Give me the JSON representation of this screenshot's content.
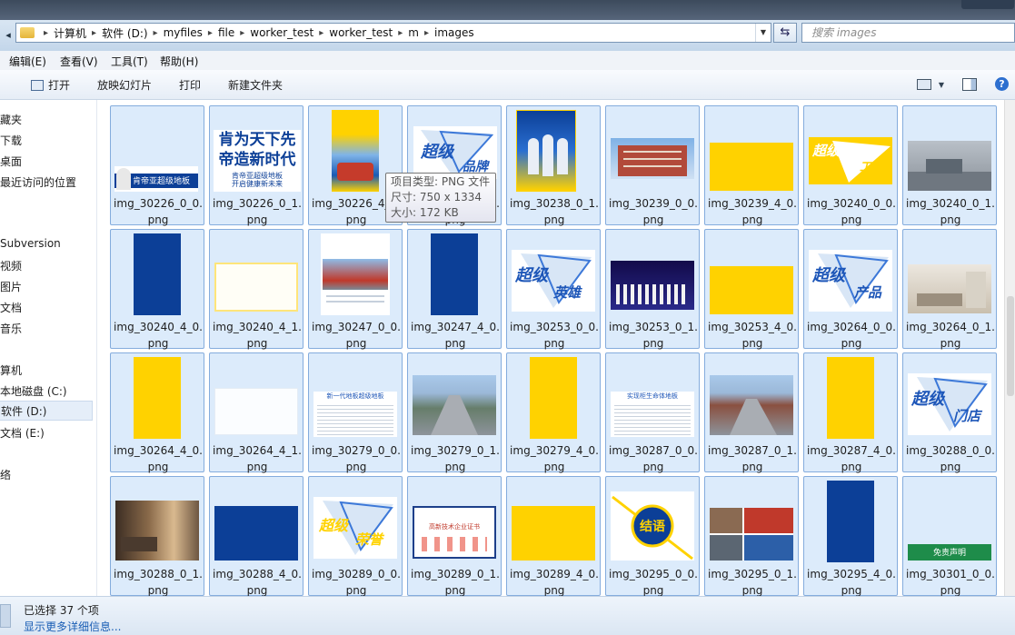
{
  "address": {
    "crumbs": [
      "计算机",
      "软件 (D:)",
      "myfiles",
      "file",
      "worker_test",
      "worker_test",
      "m",
      "images"
    ],
    "search_placeholder": "搜索 images"
  },
  "menu": [
    "编辑(E)",
    "查看(V)",
    "工具(T)",
    "帮助(H)"
  ],
  "toolbar": {
    "open": "打开",
    "slideshow": "放映幻灯片",
    "print": "打印",
    "new_folder": "新建文件夹"
  },
  "sidebar": [
    "藏夹",
    "下载",
    "桌面",
    "最近访问的位置",
    "Subversion",
    "视频",
    "图片",
    "文档",
    "音乐",
    "算机",
    "本地磁盘 (C:)",
    "软件 (D:)",
    "文档 (E:)",
    "络"
  ],
  "files": [
    {
      "name": "img_30226_0_0.png",
      "icon": "brand-banner-thumbnail"
    },
    {
      "name": "img_30226_0_1.png",
      "icon": "slogan-text-thumbnail"
    },
    {
      "name": "img_30226_4_0.png",
      "icon": "yellow-poster-thumbnail"
    },
    {
      "name": "img_30226_4_1.png",
      "icon": "super-brand-thumbnail"
    },
    {
      "name": "img_30238_0_1.png",
      "icon": "team-poster-thumbnail"
    },
    {
      "name": "img_30239_0_0.png",
      "icon": "building-photo-thumbnail"
    },
    {
      "name": "img_30239_4_0.png",
      "icon": "yellow-block-thumbnail"
    },
    {
      "name": "img_30240_0_0.png",
      "icon": "super-factory-thumbnail"
    },
    {
      "name": "img_30240_0_1.png",
      "icon": "factory-photo-thumbnail"
    },
    {
      "name": "img_30240_4_0.png",
      "icon": "blue-block-thumbnail"
    },
    {
      "name": "img_30240_4_1.png",
      "icon": "blank-frame-thumbnail"
    },
    {
      "name": "img_30247_0_0.png",
      "icon": "document-photo-thumbnail"
    },
    {
      "name": "img_30247_4_0.png",
      "icon": "blue-block-thumbnail"
    },
    {
      "name": "img_30253_0_0.png",
      "icon": "super-hero-thumbnail"
    },
    {
      "name": "img_30253_0_1.png",
      "icon": "stage-photo-thumbnail"
    },
    {
      "name": "img_30253_4_0.png",
      "icon": "yellow-block-thumbnail"
    },
    {
      "name": "img_30264_0_0.png",
      "icon": "super-product-thumbnail"
    },
    {
      "name": "img_30264_0_1.png",
      "icon": "room-photo-thumbnail"
    },
    {
      "name": "img_30264_4_0.png",
      "icon": "yellow-block-thumbnail"
    },
    {
      "name": "img_30264_4_1.png",
      "icon": "blank-frame-thumbnail"
    },
    {
      "name": "img_30279_0_0.png",
      "icon": "text-document-thumbnail"
    },
    {
      "name": "img_30279_0_1.png",
      "icon": "road-photo-thumbnail"
    },
    {
      "name": "img_30279_4_0.png",
      "icon": "yellow-block-thumbnail"
    },
    {
      "name": "img_30287_0_0.png",
      "icon": "text-document-thumbnail"
    },
    {
      "name": "img_30287_0_1.png",
      "icon": "road-photo-thumbnail"
    },
    {
      "name": "img_30287_4_0.png",
      "icon": "yellow-block-thumbnail"
    },
    {
      "name": "img_30288_0_0.png",
      "icon": "super-store-thumbnail"
    },
    {
      "name": "img_30288_0_1.png",
      "icon": "interior-photo-thumbnail"
    },
    {
      "name": "img_30288_4_0.png",
      "icon": "blue-block-thumbnail"
    },
    {
      "name": "img_30289_0_0.png",
      "icon": "super-honor-thumbnail"
    },
    {
      "name": "img_30289_0_1.png",
      "icon": "certificate-thumbnail"
    },
    {
      "name": "img_30289_4_0.png",
      "icon": "yellow-block-thumbnail"
    },
    {
      "name": "img_30295_0_0.png",
      "icon": "conclusion-badge-thumbnail"
    },
    {
      "name": "img_30295_0_1.png",
      "icon": "photo-collage-thumbnail"
    },
    {
      "name": "img_30295_4_0.png",
      "icon": "blue-block-thumbnail"
    },
    {
      "name": "img_30301_0_0.png",
      "icon": "disclaimer-banner-thumbnail"
    }
  ],
  "tooltip": {
    "type": "项目类型: PNG 文件",
    "size_dim": "尺寸: 750 x 1334",
    "size": "大小: 172 KB"
  },
  "thumb_text": {
    "brand_banner": "肯帝亚超级地板",
    "slogan_line1": "肯为天下先",
    "slogan_line2": "帝造新时代",
    "slogan_sub1": "肯帝亚超级地板",
    "slogan_sub2": "开启健康新未来",
    "super": "超级",
    "brand": "品牌",
    "factory": "工厂",
    "hero": "英雄",
    "product": "产品",
    "store": "门店",
    "honor": "荣誉",
    "conclusion": "结语",
    "disclaimer": "免责声明",
    "doc1": "新一代地板超级地板",
    "doc2": "实现柜生命体地板",
    "cert": "高新技术企业证书"
  },
  "status": {
    "selected": "已选择 37 个项",
    "more_details": "显示更多详细信息..."
  },
  "colors": {
    "selection": "#dcebfb",
    "brand_blue": "#0c3f97",
    "brand_yellow": "#ffd200"
  }
}
